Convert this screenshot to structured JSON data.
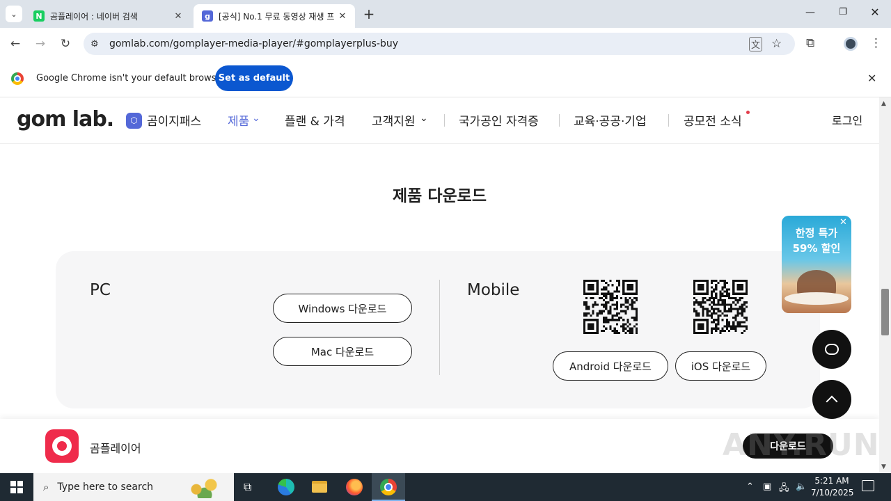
{
  "browser": {
    "tabs": [
      {
        "title": "곰플레이어 : 네이버 검색",
        "favicon": "naver-icon",
        "active": false
      },
      {
        "title": "[공식] No.1 무료 동영상 재생 프",
        "favicon": "gom-icon",
        "active": true
      }
    ],
    "url": "gomlab.com/gomplayer-media-player/#gomplayerplus-buy",
    "infobar": {
      "message": "Google Chrome isn't your default browser",
      "button": "Set as default"
    }
  },
  "site": {
    "logo": "gom lab.",
    "nav": [
      {
        "label": "곰이지패스"
      },
      {
        "label": "제품"
      },
      {
        "label": "플랜 & 가격"
      },
      {
        "label": "고객지원"
      },
      {
        "label": "국가공인 자격증"
      },
      {
        "label": "교육·공공·기업"
      },
      {
        "label": "공모전 소식"
      }
    ],
    "login": "로그인",
    "colors": {
      "accent": "#5468d8",
      "dot": "#e23c4a"
    }
  },
  "download": {
    "title": "제품 다운로드",
    "pc_label": "PC",
    "windows_button": "Windows 다운로드",
    "mac_button": "Mac 다운로드",
    "mobile_label": "Mobile",
    "android_button": "Android 다운로드",
    "ios_button": "iOS 다운로드"
  },
  "promo": {
    "line1": "한정 특가",
    "line2": "59% 할인"
  },
  "bottom": {
    "product": "곰플레이어",
    "button": "다운로드",
    "watermark": "ANY.RUN"
  },
  "taskbar": {
    "search_placeholder": "Type here to search",
    "time": "5:21 AM",
    "date": "7/10/2025"
  }
}
